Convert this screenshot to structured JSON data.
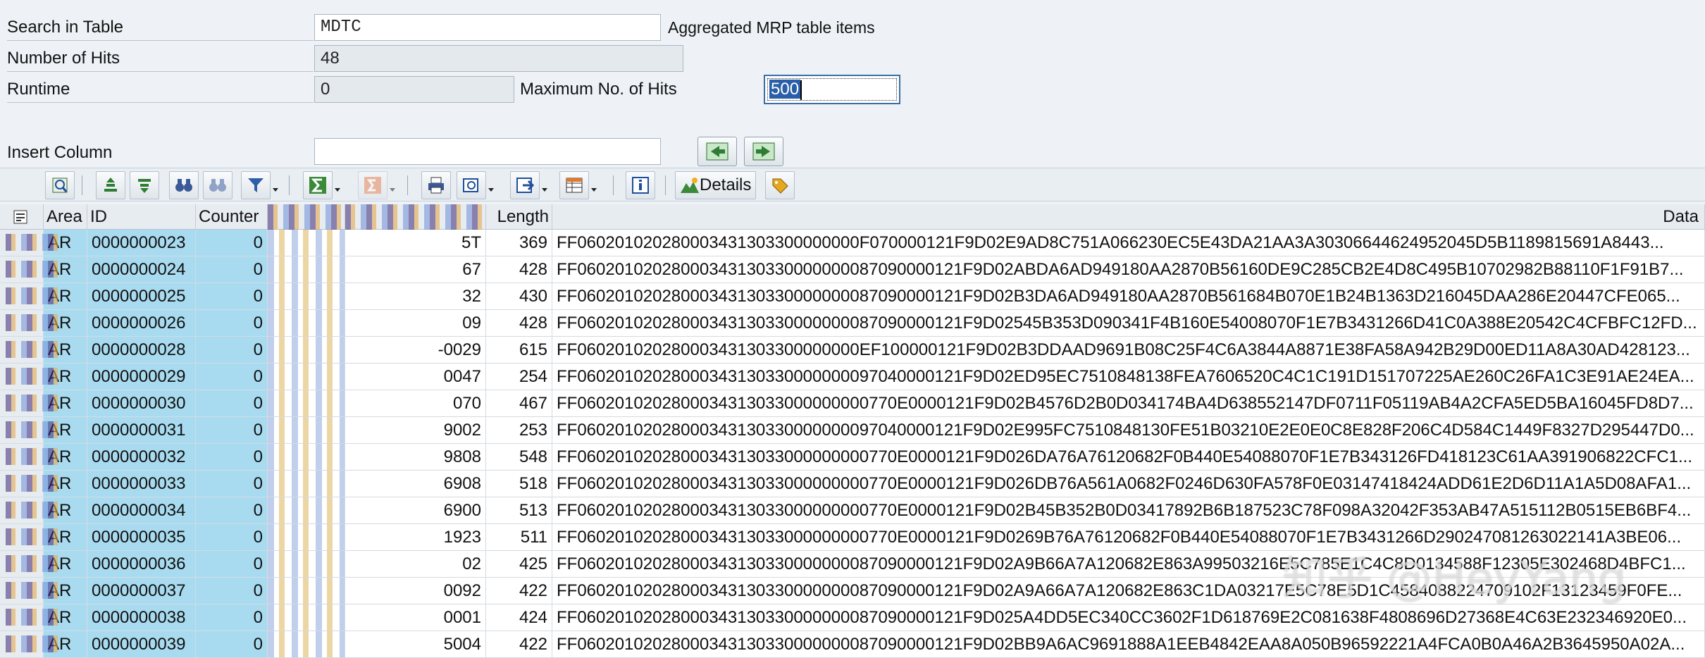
{
  "form": {
    "search_label": "Search in Table",
    "search_value": "MDTC",
    "search_desc": "Aggregated MRP table items",
    "hits_label": "Number of Hits",
    "hits_value": "48",
    "runtime_label": "Runtime",
    "runtime_value": "0",
    "max_hits_label": "Maximum No. of Hits",
    "max_hits_value": "500",
    "insert_col_label": "Insert Column",
    "insert_col_value": ""
  },
  "toolbar": {
    "details_label": "Details"
  },
  "grid": {
    "headers": {
      "area": "Area",
      "id": "ID",
      "counter": "Counter",
      "length": "Length",
      "data": "Data"
    },
    "rows": [
      {
        "area": "AR",
        "id": "0000000023",
        "counter": "0",
        "col5": "5T",
        "length": "369",
        "data": "FF060201020280003431303300000000F070000121F9D02E9AD8C751A066230EC5E43DA21AA3A30306644624952045D5B1189815691A8443..."
      },
      {
        "area": "AR",
        "id": "0000000024",
        "counter": "0",
        "col5": "67",
        "length": "428",
        "data": "FF06020102028000343130330000000087090000121F9D02ABDA6AD949180AA2870B56160DE9C285CB2E4D8C495B10702982B88110F1F91B7..."
      },
      {
        "area": "AR",
        "id": "0000000025",
        "counter": "0",
        "col5": "32",
        "length": "430",
        "data": "FF06020102028000343130330000000087090000121F9D02B3DA6AD949180AA2870B561684B070E1B24B1363D216045DAA286E20447CFE065..."
      },
      {
        "area": "AR",
        "id": "0000000026",
        "counter": "0",
        "col5": "09",
        "length": "428",
        "data": "FF06020102028000343130330000000087090000121F9D02545B353D090341F4B160E54008070F1E7B3431266D41C0A388E20542C4CFBFC12FD..."
      },
      {
        "area": "AR",
        "id": "0000000028",
        "counter": "0",
        "col5": "-0029",
        "length": "615",
        "data": "FF060201020280003431303300000000EF100000121F9D02B3DDAAD9691B08C25F4C6A3844A8871E38FA58A942B29D00ED11A8A30AD428123..."
      },
      {
        "area": "AR",
        "id": "0000000029",
        "counter": "0",
        "col5": "0047",
        "length": "254",
        "data": "FF06020102028000343130330000000097040000121F9D02ED95EC7510848138FEA7606520C4C1C191D151707225AE260C26FA1C3E91AE24EA..."
      },
      {
        "area": "AR",
        "id": "0000000030",
        "counter": "0",
        "col5": "070",
        "length": "467",
        "data": "FF0602010202800034313033000000000770E0000121F9D02B4576D2B0D034174BA4D638552147DF0711F05119AB4A2CFA5ED5BA16045FD8D7..."
      },
      {
        "area": "AR",
        "id": "0000000031",
        "counter": "0",
        "col5": "9002",
        "length": "253",
        "data": "FF06020102028000343130330000000097040000121F9D02E995FC7510848130FE51B03210E2E0E0C8E828F206C4D584C1449F8327D295447D0..."
      },
      {
        "area": "AR",
        "id": "0000000032",
        "counter": "0",
        "col5": "9808",
        "length": "548",
        "data": "FF0602010202800034313033000000000770E0000121F9D026DA76A76120682F0B440E54088070F1E7B343126FD418123C61AA391906822CFC1..."
      },
      {
        "area": "AR",
        "id": "0000000033",
        "counter": "0",
        "col5": "6908",
        "length": "518",
        "data": "FF0602010202800034313033000000000770E0000121F9D026DB76A561A0682F0246D630FA578F0E03147418424ADD61E2D6D11A1A5D08AFA1..."
      },
      {
        "area": "AR",
        "id": "0000000034",
        "counter": "0",
        "col5": "6900",
        "length": "513",
        "data": "FF0602010202800034313033000000000770E0000121F9D02B45B352B0D03417892B6B187523C78F098A32042F353AB47A515112B0515EB6BF4..."
      },
      {
        "area": "AR",
        "id": "0000000035",
        "counter": "0",
        "col5": "1923",
        "length": "511",
        "data": "FF0602010202800034313033000000000770E0000121F9D0269B76A76120682F0B440E54088070F1E7B3431266D290247081263022141A3BE06..."
      },
      {
        "area": "AR",
        "id": "0000000036",
        "counter": "0",
        "col5": "02",
        "length": "425",
        "data": "FF06020102028000343130330000000087090000121F9D02A9B66A7A120682E863A99503216E5C785E1C4C8D0134588F12305E302468D4BFC1..."
      },
      {
        "area": "AR",
        "id": "0000000037",
        "counter": "0",
        "col5": "0092",
        "length": "422",
        "data": "FF06020102028000343130330000000087090000121F9D02A9A66A7A120682E863C1DA03217E5C78E5D1C4584088224709102F13123459F0FE..."
      },
      {
        "area": "AR",
        "id": "0000000038",
        "counter": "0",
        "col5": "0001",
        "length": "424",
        "data": "FF06020102028000343130330000000087090000121F9D025A4DD5EC340CC3602F1D618769E2C081638F4808696D27368E4C63E232346920E0..."
      },
      {
        "area": "AR",
        "id": "0000000039",
        "counter": "0",
        "col5": "5004",
        "length": "422",
        "data": "FF06020102028000343130330000000087090000121F9D02BB9A6AC9691888A1EEB4842EAA8A050B96592221A4FCA0B0A46A2B3645950A02A..."
      }
    ]
  },
  "watermark": "知乎 @HeyYang",
  "colors": {
    "key_column": "#a9dbf0",
    "focus_border": "#3a6ea8",
    "background": "#eef2f6"
  }
}
